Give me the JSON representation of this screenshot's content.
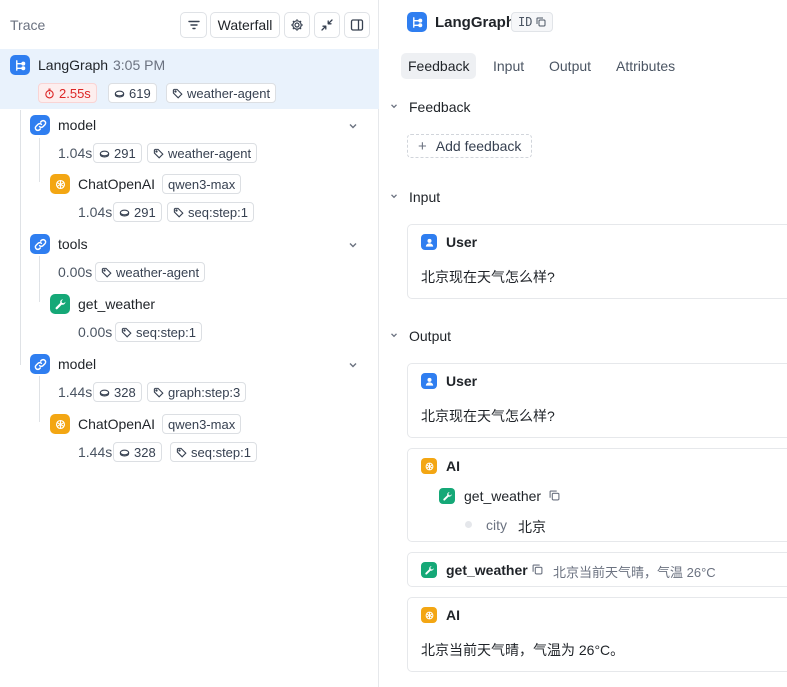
{
  "trace": {
    "title": "Trace",
    "waterfall_label": "Waterfall"
  },
  "root": {
    "name": "LangGraph",
    "time": "3:05 PM",
    "latency": "2.55s",
    "tokens": "619",
    "tag": "weather-agent"
  },
  "nodes": [
    {
      "name": "model",
      "latency": "1.04s",
      "tokens": "291",
      "tag": "weather-agent"
    },
    {
      "name": "ChatOpenAI",
      "model_badge": "qwen3-max",
      "latency": "1.04s",
      "tokens": "291",
      "tag": "seq:step:1"
    },
    {
      "name": "tools",
      "latency": "0.00s",
      "tag": "weather-agent"
    },
    {
      "name": "get_weather",
      "latency": "0.00s",
      "tag": "seq:step:1"
    },
    {
      "name": "model",
      "latency": "1.44s",
      "tokens": "328",
      "tag": "graph:step:3"
    },
    {
      "name": "ChatOpenAI",
      "model_badge": "qwen3-max",
      "latency": "1.44s",
      "tokens": "328",
      "tag": "seq:step:1"
    }
  ],
  "detail": {
    "title": "LangGraph",
    "id_label": "ID",
    "tabs": [
      "Feedback",
      "Input",
      "Output",
      "Attributes"
    ],
    "feedback": {
      "title": "Feedback",
      "add_label": "Add feedback"
    },
    "input": {
      "title": "Input",
      "role": "User",
      "text": "北京现在天气怎么样?"
    },
    "output": {
      "title": "Output",
      "user_role": "User",
      "user_text": "北京现在天气怎么样?",
      "ai_role": "AI",
      "tool_call_name": "get_weather",
      "arg_key": "city",
      "arg_value": "北京",
      "tool_result_name": "get_weather",
      "tool_result_text": "北京当前天气晴，气温 26°C",
      "ai_role_2": "AI",
      "ai_text": "北京当前天气晴，气温为 26°C。"
    }
  },
  "colors": {
    "accent_blue": "#2f7ef0",
    "llm_orange": "#f3a613",
    "tool_green": "#15a877",
    "selected_row": "#e9f2fc",
    "latency_red": "#dc2626"
  }
}
